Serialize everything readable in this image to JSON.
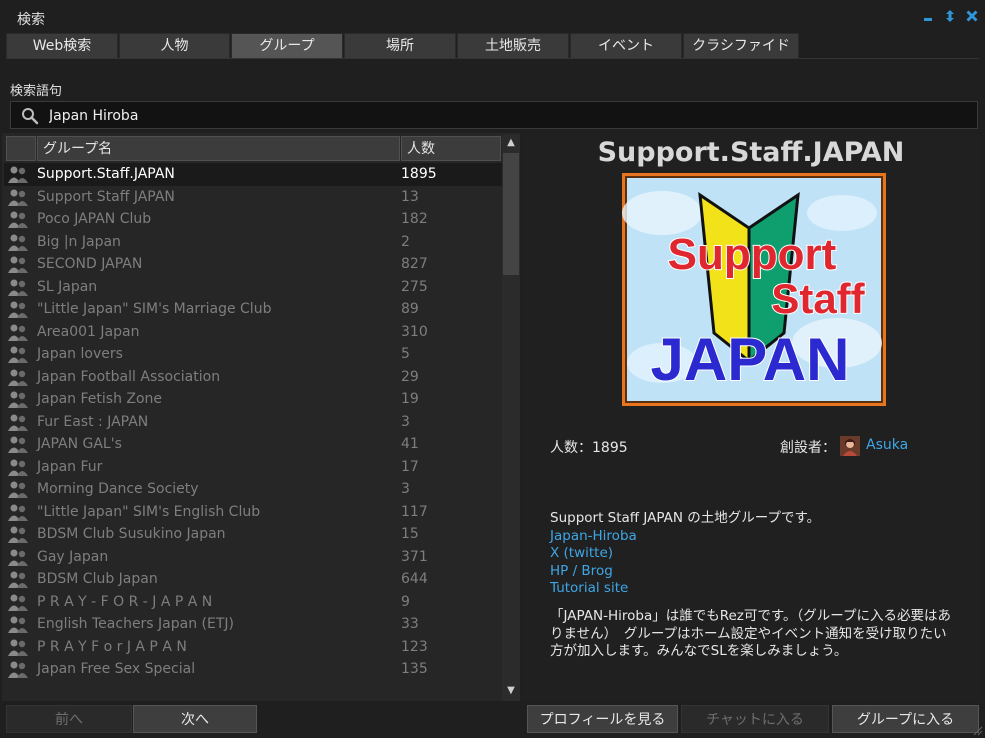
{
  "window": {
    "title": "検索"
  },
  "tabs": [
    "Web検索",
    "人物",
    "グループ",
    "場所",
    "土地販売",
    "イベント",
    "クラシファイド"
  ],
  "active_tab": 2,
  "search": {
    "label": "検索語句",
    "value": "Japan Hiroba",
    "icon": "search-icon"
  },
  "table": {
    "headers": {
      "name": "グループ名",
      "count": "人数"
    },
    "rows": [
      {
        "name": "Support.Staff.JAPAN",
        "count": "1895"
      },
      {
        "name": "Support Staff JAPAN",
        "count": "13"
      },
      {
        "name": "Poco JAPAN Club",
        "count": "182"
      },
      {
        "name": "Big |n Japan",
        "count": "2"
      },
      {
        "name": "SECOND JAPAN",
        "count": "827"
      },
      {
        "name": "SL Japan",
        "count": "275"
      },
      {
        "name": "\"Little Japan\" SIM's Marriage Club",
        "count": "89"
      },
      {
        "name": "Area001 Japan",
        "count": "310"
      },
      {
        "name": "Japan lovers",
        "count": "5"
      },
      {
        "name": "Japan Football Association",
        "count": "29"
      },
      {
        "name": "Japan Fetish Zone",
        "count": "19"
      },
      {
        "name": "Fur East : JAPAN",
        "count": "3"
      },
      {
        "name": "JAPAN GAL's",
        "count": "41"
      },
      {
        "name": "Japan Fur",
        "count": "17"
      },
      {
        "name": "Morning Dance Society",
        "count": "3"
      },
      {
        "name": "\"Little Japan\" SIM's English Club",
        "count": "117"
      },
      {
        "name": "BDSM Club Susukino Japan",
        "count": "15"
      },
      {
        "name": "Gay Japan",
        "count": "371"
      },
      {
        "name": "BDSM Club Japan",
        "count": "644"
      },
      {
        "name": "P R A Y - F O R - J A P A N",
        "count": "9"
      },
      {
        "name": "English Teachers Japan (ETJ)",
        "count": "33"
      },
      {
        "name": "P R A Y   F o r   J A P A N",
        "count": "123"
      },
      {
        "name": "Japan Free Sex Special",
        "count": "135"
      }
    ],
    "selected_index": 0
  },
  "pager": {
    "prev": "前へ",
    "next": "次へ"
  },
  "detail": {
    "title": "Support.Staff.JAPAN",
    "logo": {
      "line1": "Support",
      "line2": "Staff",
      "line3": "JAPAN"
    },
    "members_label": "人数：1895",
    "founder_label": "創設者：",
    "founder_name": "Asuka",
    "description_intro": "Support Staff JAPAN の土地グループです。",
    "links": [
      "Japan-Hiroba",
      "X (twitte)",
      "HP / Brog",
      "Tutorial site"
    ],
    "description_body": "「JAPAN-Hiroba」は誰でもRez可です。（グループに入る必要はありません）　グループはホーム設定やイベント通知を受け取りたい方が加入します。みんなでSLを楽しみましょう。"
  },
  "actions": {
    "profile": "プロフィールを見る",
    "chat": "チャットに入る",
    "join": "グループに入る"
  },
  "colors": {
    "accent": "#2f96d8",
    "link": "#3fa6e6",
    "logo_red": "#e0262e",
    "logo_blue": "#2a2ad0",
    "logo_green": "#0f9e6e",
    "logo_yellow": "#f2e21a",
    "logo_border": "#e8741e"
  }
}
